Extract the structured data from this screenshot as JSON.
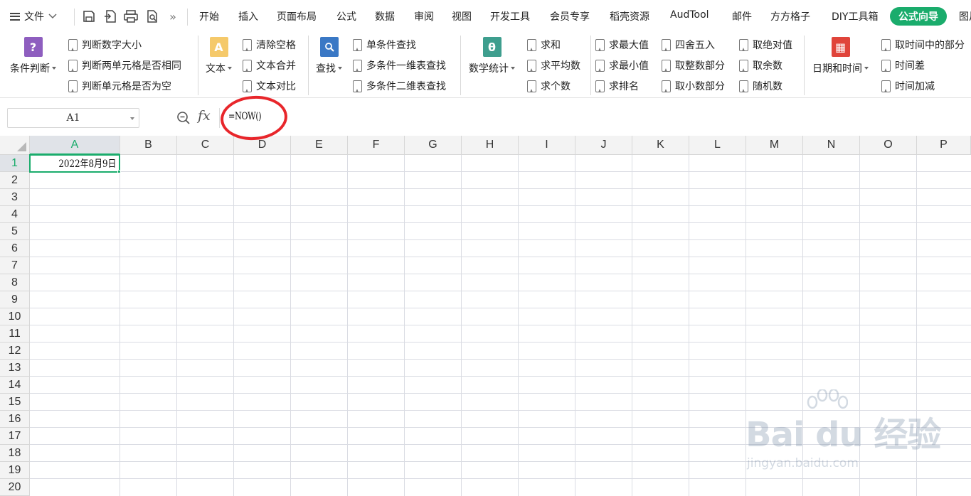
{
  "menubar": {
    "file_label": "文件",
    "more_label": "»",
    "tabs": [
      "开始",
      "插入",
      "页面布局",
      "公式",
      "数据",
      "审阅",
      "视图",
      "开发工具",
      "会员专享",
      "稻壳资源",
      "AudTool",
      "邮件",
      "方方格子",
      "DIY工具箱",
      "公式向导",
      "图片"
    ]
  },
  "ribbon": {
    "groups": [
      {
        "big": "条件判断",
        "icon_color": "#8e5ebf",
        "icon_glyph": "?",
        "items": [
          "判断数字大小",
          "判断两单元格是否相同",
          "判断单元格是否为空"
        ]
      },
      {
        "big": "文本",
        "icon_color": "#f2b84b",
        "icon_glyph": "A",
        "items": [
          "清除空格",
          "文本合并",
          "文本对比"
        ]
      },
      {
        "big": "查找",
        "icon_color": "#3a78c5",
        "icon_glyph": "Q",
        "items": [
          "单条件查找",
          "多条件一维表查找",
          "多条件二维表查找"
        ]
      },
      {
        "big": "数学统计",
        "icon_color": "#3e9e8e",
        "icon_glyph": "θ",
        "items": [
          "求和",
          "求平均数",
          "求个数",
          "求最大值",
          "求最小值",
          "求排名",
          "四舍五入",
          "取整数部分",
          "取小数部分",
          "取绝对值",
          "取余数",
          "随机数"
        ]
      },
      {
        "big": "日期和时间",
        "icon_color": "#e0443a",
        "icon_glyph": "▦",
        "items": [
          "取时间中的部分",
          "时间差",
          "时间加减"
        ]
      }
    ]
  },
  "formula_bar": {
    "cell_ref": "A1",
    "fx_label": "fx",
    "formula": "=NOW()"
  },
  "sheet": {
    "columns": [
      "A",
      "B",
      "C",
      "D",
      "E",
      "F",
      "G",
      "H",
      "I",
      "J",
      "K",
      "L",
      "M",
      "N",
      "O",
      "P"
    ],
    "rows": [
      "1",
      "2",
      "3",
      "4",
      "5",
      "6",
      "7",
      "8",
      "9",
      "10",
      "11",
      "12",
      "13",
      "14",
      "15",
      "16",
      "17",
      "18",
      "19",
      "20"
    ],
    "selected_cell": "A1",
    "a1_value": "2022年8月9日"
  },
  "colors": {
    "accent": "#1aac6c",
    "annotation": "#e8262b"
  },
  "watermark": {
    "main": "Bai du 经验",
    "sub": "jingyan.baidu.com"
  }
}
